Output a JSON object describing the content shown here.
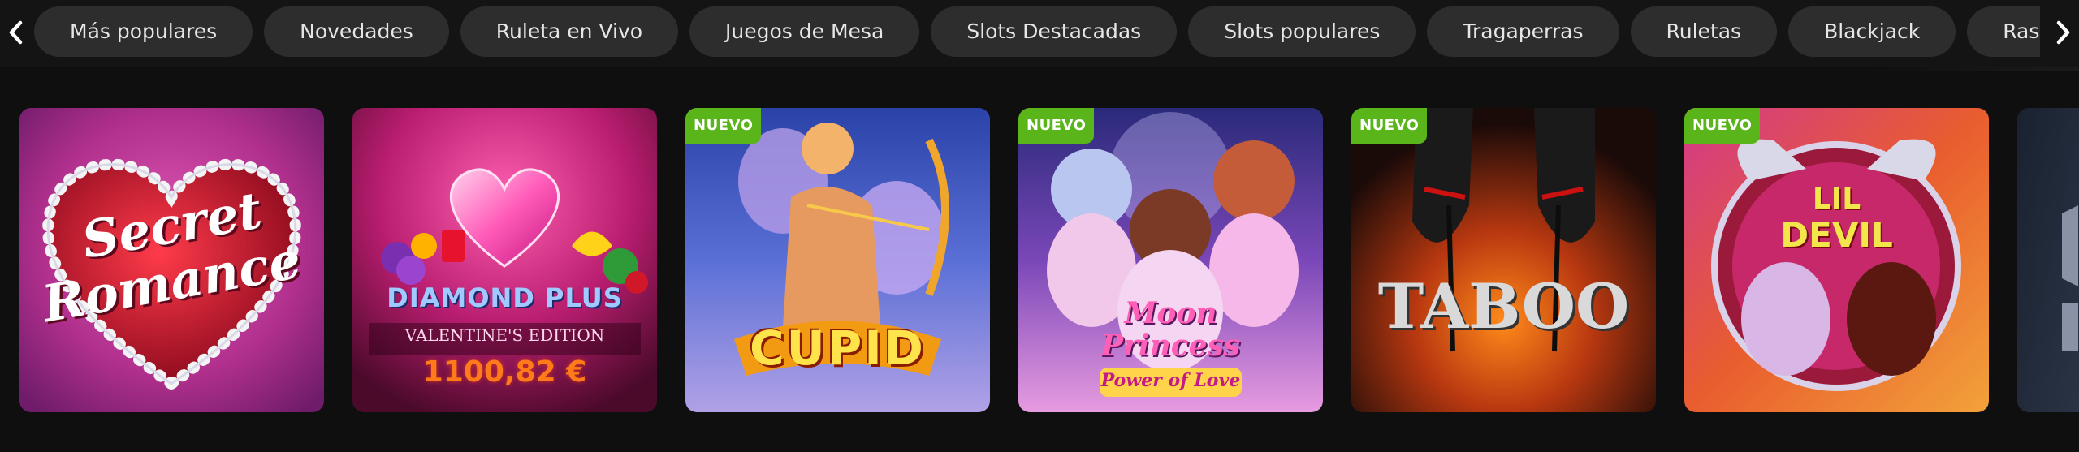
{
  "categories": [
    "Más populares",
    "Novedades",
    "Ruleta en Vivo",
    "Juegos de Mesa",
    "Slots Destacadas",
    "Slots populares",
    "Tragaperras",
    "Ruletas",
    "Blackjack",
    "Rasca y Gana"
  ],
  "games": [
    {
      "title_line1": "Secret",
      "title_line2": "Romance"
    },
    {
      "title_line1": "DIAMOND PLUS",
      "title_line2": "VALENTINE'S EDITION",
      "jackpot": "1100,82 €"
    },
    {
      "badge": "NUEVO",
      "title": "CUPID"
    },
    {
      "badge": "NUEVO",
      "title_line1": "Moon",
      "title_line2": "Princess",
      "title_line3": "Power of Love"
    },
    {
      "badge": "NUEVO",
      "title": "TABOO"
    },
    {
      "badge": "NUEVO",
      "title_line1": "LIL",
      "title_line2": "DEVIL"
    }
  ],
  "colors": {
    "background": "#0f0f0f",
    "chip": "#2d2d2d",
    "badge": "#59b51a",
    "jackpot": "#ff7a1a"
  },
  "icons": {
    "left": "chevron-left-icon",
    "right": "chevron-right-icon"
  }
}
